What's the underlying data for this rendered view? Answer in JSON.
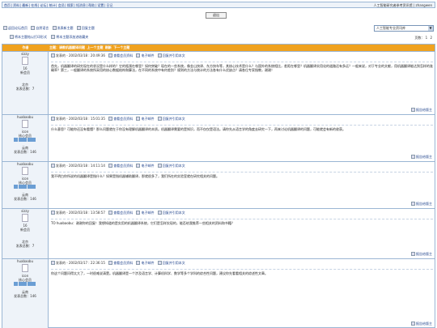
{
  "topbar": {
    "links": [
      "首页",
      "资料",
      "最新",
      "在线",
      "论坛",
      "统计",
      "会员",
      "搜索",
      "短消息",
      "帮助",
      "设置",
      "日记"
    ],
    "right": "人工智能研究者参考资讯馆 | zhangwen"
  },
  "logout_label": "退出",
  "breadcrumb": {
    "home": "返回论坛首页",
    "forum": "自然语言",
    "post": "发表新主题",
    "reply": "回复主题"
  },
  "breadcrumb2": {
    "print": "将本主题帖以打印形式",
    "fav": "将本主题添加进收藏夹"
  },
  "board_select": "人工智能专业资讯库",
  "pager": {
    "label": "页数：",
    "pages": [
      "1",
      "2"
    ]
  },
  "thead": {
    "author": "作者",
    "subject": "主题：请教机器翻译问题",
    "prev": "上一个主题",
    "refresh": "刷新",
    "next": "下一个主题"
  },
  "posts": [
    {
      "user": "sizzy",
      "avatar_label": "16",
      "role": "新会员",
      "place": "北京",
      "posts": "发表总数：7",
      "time": "发表的 - 2002/03/18 : 20:49:36",
      "links": [
        "查看会员资料",
        "电子邮件",
        "回复并引用本文"
      ],
      "text": "首先，机器翻译的研究现在的状况是什么样的？它的瓶颈在哪里？如何突破？现在的一些系统，像金山快译、东方快车等，其核心技术是什么？与国外的系统相比，差距在哪里？机器翻译实用化的道路还有多远？一般来说，对于专业的文献，用机器翻译能达到怎样的准确率？第三，一般翻译的系统所采用的核心数据结构和算法，在不同的系统中有何差别？规则的方法与统计的方法各有什么优缺点？请各位专家指教，谢谢！"
    },
    {
      "user": "huabaobu",
      "avatar_label": "icon",
      "role": "核心会员",
      "place": "云南",
      "posts": "发表总数：146",
      "time": "发表的 - 2002/03/18 : 15:01:35",
      "links": [
        "查看会员资料",
        "电子邮件",
        "回复并引用本文"
      ],
      "text": "什么意思？可能你还没有看懂？那么问题就在于你没有理解机器翻译的本质。机器翻译需要的是知识，而不仅仅是语法。请你先从语言学的角度去研究一下，再来讨论机器翻译的问题，可能就会有新的收获。"
    },
    {
      "user": "huabaobu",
      "avatar_label": "icon",
      "role": "核心会员",
      "place": "云南",
      "posts": "发表总数：146",
      "time": "发表的 - 2002/03/18 : 14:11:14",
      "links": [
        "查看会员资料",
        "电子邮件",
        "回复并引用本文"
      ],
      "text": "我不明白你所说的机器翻译是指什么？如果是指机器辅助翻译，那就很多了，我们所在的实验室就在研究相关的问题。"
    },
    {
      "user": "sizzy",
      "avatar_label": "16",
      "role": "新会员",
      "place": "北京",
      "posts": "发表总数：7",
      "time": "发表的 - 2002/03/18 : 13:58:57",
      "links": [
        "查看会员资料",
        "电子邮件",
        "回复并引用本文"
      ],
      "text": "TO huabaobu：谢谢你的回复！我想知道的是实用的机器翻译系统，它们是怎样实现的，能否给我推荐一些相关的资料和书籍？"
    },
    {
      "user": "huabaobu",
      "avatar_label": "icon",
      "role": "核心会员",
      "place": "云南",
      "posts": "发表总数：146",
      "time": "发表的 - 2002/03/17 : 22:36:15",
      "links": [
        "查看会员资料",
        "电子邮件",
        "回复并引用本文"
      ],
      "text": "你这个问题问得太大了，一时很难说清楚。机器翻译是一个涉及语言学、计算机科学、数学等多个学科的综合性问题，建议你先看看相关的综述性文章。"
    }
  ],
  "report_label": "报告给版主"
}
